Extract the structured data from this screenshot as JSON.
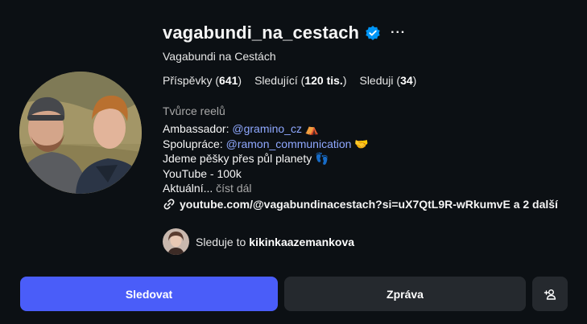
{
  "profile": {
    "username": "vagabundi_na_cestach",
    "full_name": "Vagabundi na Cestách",
    "more_icon": "more-horizontal-icon",
    "verified_icon": "verified-badge-icon"
  },
  "stats": {
    "posts_label": "Příspěvky",
    "posts_value": "641",
    "followers_label": "Sledující",
    "followers_value": "120 tis.",
    "following_label": "Sleduji",
    "following_value": "34"
  },
  "bio": {
    "category": "Tvůrce reelů",
    "ambassador_prefix": "Ambassador:",
    "ambassador_mention": "@gramino_cz",
    "ambassador_emoji": "⛺",
    "collab_prefix": "Spolupráce:",
    "collab_mention": "@ramon_communication",
    "collab_emoji": "🤝",
    "line3": "Jdeme pěšky přes půl planety",
    "line3_emoji": "👣",
    "line4": "YouTube - 100k",
    "line5": "Aktuální",
    "line5_ellipsis": "...",
    "read_more": "číst dál"
  },
  "link": {
    "icon": "link-icon",
    "text": "youtube.com/@vagabundinacestach?si=uX7QtL9R-wRkumvE a 2 další"
  },
  "followed_by": {
    "prefix": "Sleduje to",
    "user": "kikinkaazemankova"
  },
  "actions": {
    "follow": "Sledovat",
    "message": "Zpráva",
    "add_icon": "add-user-icon"
  },
  "colors": {
    "background": "#0c1014",
    "primary_button": "#4a5df9",
    "secondary_button": "#25292e",
    "mention": "#8fa8ff",
    "verified": "#0095f6"
  }
}
